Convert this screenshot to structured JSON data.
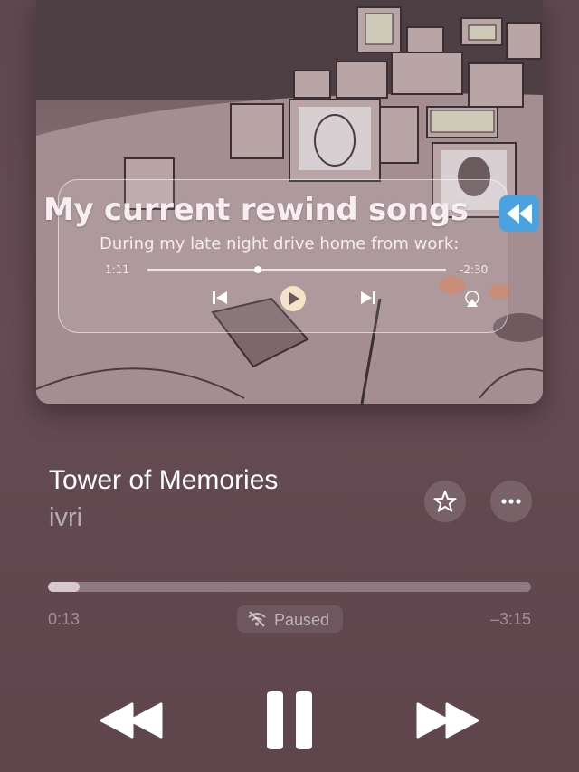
{
  "artwork": {
    "overlay_title": "My current rewind songs",
    "overlay_emoji": "rewind-emoji",
    "overlay_subtitle": "During my late night drive home from work:",
    "mini_player": {
      "elapsed": "1:11",
      "remaining": "-2:30",
      "progress": 0.37
    }
  },
  "track": {
    "title": "Tower of Memories",
    "artist": "ivri"
  },
  "playback": {
    "elapsed": "0:13",
    "remaining": "–3:15",
    "status": "Paused",
    "progress": 0.065
  },
  "icons": {
    "favorite": "star-icon",
    "more": "ellipsis-icon",
    "status": "wifi-off-icon",
    "previous": "rewind-icon",
    "play_pause": "pause-icon",
    "next": "fast-forward-icon"
  },
  "colors": {
    "background": "#634a51",
    "progress_fill": "#d6c8cc"
  }
}
